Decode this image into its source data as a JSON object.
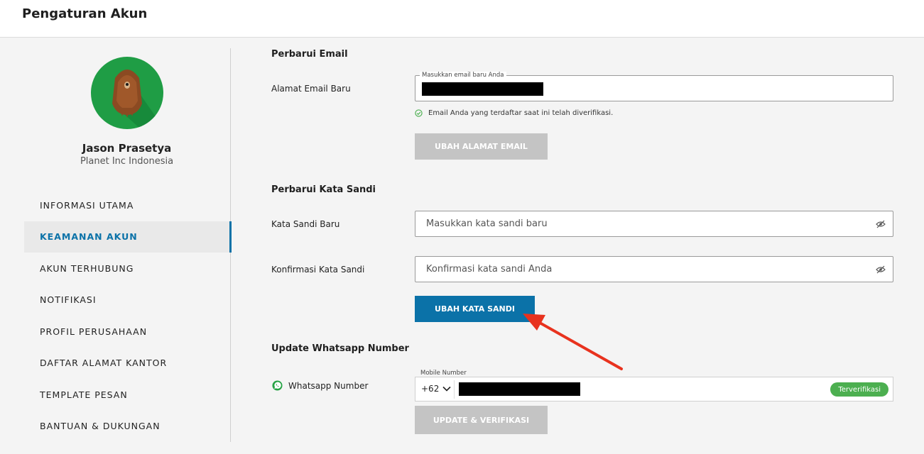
{
  "header": {
    "title": "Pengaturan Akun"
  },
  "profile": {
    "name": "Jason Prasetya",
    "company": "Planet Inc Indonesia"
  },
  "sidebar": {
    "items": [
      {
        "label": "INFORMASI UTAMA",
        "active": false
      },
      {
        "label": "KEAMANAN AKUN",
        "active": true
      },
      {
        "label": "AKUN TERHUBUNG",
        "active": false
      },
      {
        "label": "NOTIFIKASI",
        "active": false
      },
      {
        "label": "PROFIL PERUSAHAAN",
        "active": false
      },
      {
        "label": "DAFTAR ALAMAT KANTOR",
        "active": false
      },
      {
        "label": "TEMPLATE PESAN",
        "active": false
      },
      {
        "label": "BANTUAN & DUKUNGAN",
        "active": false
      }
    ]
  },
  "email_section": {
    "title": "Perbarui Email",
    "field_label": "Alamat Email Baru",
    "floating_label": "Masukkan email baru Anda",
    "verified_note": "Email Anda yang terdaftar saat ini telah diverifikasi.",
    "button_label": "UBAH ALAMAT EMAIL"
  },
  "password_section": {
    "title": "Perbarui Kata Sandi",
    "new_label": "Kata Sandi Baru",
    "new_placeholder": "Masukkan kata sandi baru",
    "confirm_label": "Konfirmasi Kata Sandi",
    "confirm_placeholder": "Konfirmasi kata sandi Anda",
    "button_label": "UBAH KATA SANDI"
  },
  "whatsapp_section": {
    "title": "Update Whatsapp Number",
    "field_label": "Whatsapp Number",
    "floating_label": "Mobile Number",
    "country_code": "+62",
    "badge": "Terverifikasi",
    "button_label": "UPDATE & VERIFIKASI"
  },
  "colors": {
    "primary": "#0b72a8",
    "avatar_bg": "#1f9d45",
    "verified_badge": "#4caf50",
    "disabled_button": "#c4c4c4",
    "annotation_arrow": "#e8321e"
  }
}
